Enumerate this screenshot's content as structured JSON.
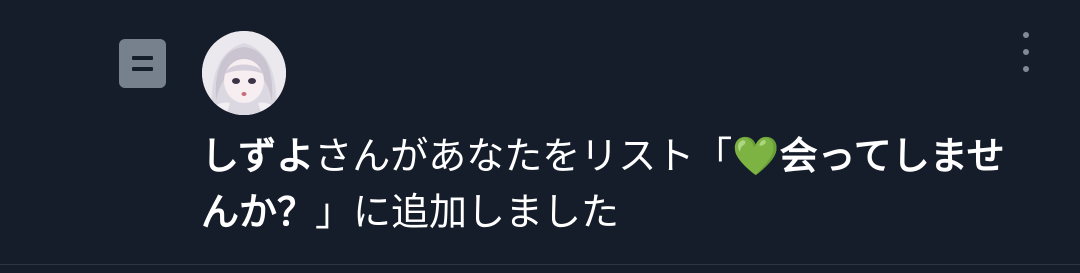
{
  "notification": {
    "user_name": "しずよ",
    "message_part1": "さんがあなたをリスト",
    "list_open_bracket": "「",
    "list_emoji": "💚",
    "list_title": "会ってしませんか？",
    "list_close_bracket": "」",
    "message_part2": "に追加しました",
    "list_icon": "list-icon",
    "more_icon": "more-vertical-icon",
    "accent_color": "#3fbf4f",
    "background_color": "#161d2a"
  }
}
